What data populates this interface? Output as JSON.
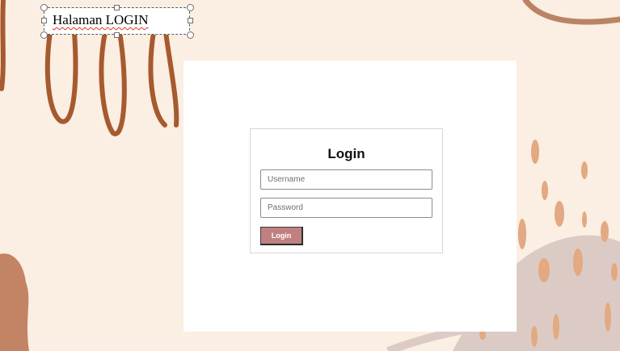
{
  "textbox": {
    "text": "Halaman LOGIN"
  },
  "login": {
    "title": "Login",
    "username_placeholder": "Username",
    "password_placeholder": "Password",
    "button_label": "Login"
  },
  "colors": {
    "background": "#fbeee2",
    "button": "#c08082",
    "decor_brown": "#a0522d",
    "decor_dot": "#e0aa84"
  }
}
